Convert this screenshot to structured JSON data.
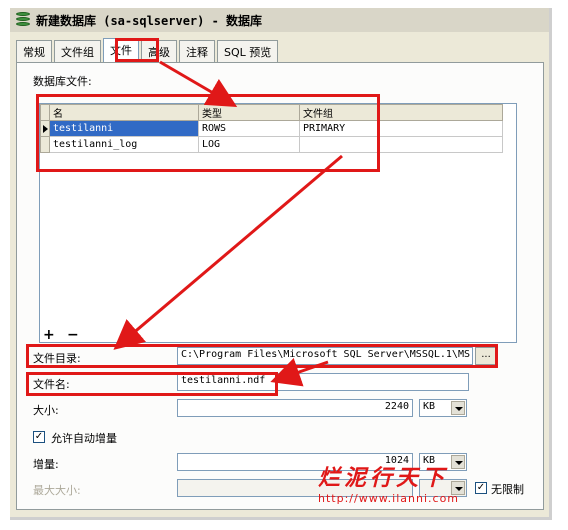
{
  "window": {
    "title": "新建数据库 (sa-sqlserver) - 数据库"
  },
  "tabs": [
    {
      "label": "常规"
    },
    {
      "label": "文件组"
    },
    {
      "label": "文件",
      "active": true
    },
    {
      "label": "高级"
    },
    {
      "label": "注释"
    },
    {
      "label": "SQL 预览"
    }
  ],
  "files_section": {
    "label": "数据库文件:",
    "columns": [
      "名",
      "类型",
      "文件组"
    ],
    "rows": [
      {
        "name": "testilanni",
        "type": "ROWS",
        "filegroup": "PRIMARY",
        "selected": true
      },
      {
        "name": "testilanni_log",
        "type": "LOG",
        "filegroup": ""
      }
    ],
    "add_label": "+",
    "remove_label": "−"
  },
  "properties": {
    "directory_label": "文件目录:",
    "directory_value": "C:\\Program Files\\Microsoft SQL Server\\MSSQL.1\\MS",
    "browse_label": "...",
    "filename_label": "文件名:",
    "filename_value": "testilanni.ndf",
    "size_label": "大小:",
    "size_value": "2240",
    "size_unit": "KB",
    "autogrow_label": "允许自动增量",
    "autogrow_checked": true,
    "growth_label": "增量:",
    "growth_value": "1024",
    "growth_unit": "KB",
    "maxsize_label": "最大大小:",
    "maxsize_value": "",
    "unlimited_label": "无限制",
    "unlimited_checked": true
  },
  "watermark": {
    "text": "烂泥行天下",
    "url": "http://www.ilanni.com"
  },
  "colors": {
    "annotation_red": "#e01818",
    "selection_blue": "#316ac5",
    "dialog_bg": "#ece9d8"
  }
}
